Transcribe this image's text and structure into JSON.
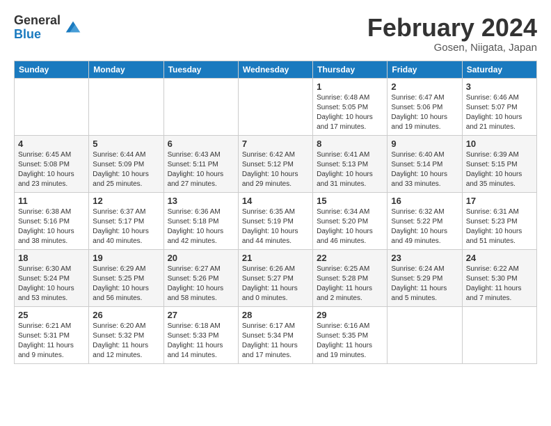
{
  "logo": {
    "general": "General",
    "blue": "Blue"
  },
  "title": "February 2024",
  "location": "Gosen, Niigata, Japan",
  "weekdays": [
    "Sunday",
    "Monday",
    "Tuesday",
    "Wednesday",
    "Thursday",
    "Friday",
    "Saturday"
  ],
  "weeks": [
    [
      {
        "day": "",
        "info": ""
      },
      {
        "day": "",
        "info": ""
      },
      {
        "day": "",
        "info": ""
      },
      {
        "day": "",
        "info": ""
      },
      {
        "day": "1",
        "info": "Sunrise: 6:48 AM\nSunset: 5:05 PM\nDaylight: 10 hours and 17 minutes."
      },
      {
        "day": "2",
        "info": "Sunrise: 6:47 AM\nSunset: 5:06 PM\nDaylight: 10 hours and 19 minutes."
      },
      {
        "day": "3",
        "info": "Sunrise: 6:46 AM\nSunset: 5:07 PM\nDaylight: 10 hours and 21 minutes."
      }
    ],
    [
      {
        "day": "4",
        "info": "Sunrise: 6:45 AM\nSunset: 5:08 PM\nDaylight: 10 hours and 23 minutes."
      },
      {
        "day": "5",
        "info": "Sunrise: 6:44 AM\nSunset: 5:09 PM\nDaylight: 10 hours and 25 minutes."
      },
      {
        "day": "6",
        "info": "Sunrise: 6:43 AM\nSunset: 5:11 PM\nDaylight: 10 hours and 27 minutes."
      },
      {
        "day": "7",
        "info": "Sunrise: 6:42 AM\nSunset: 5:12 PM\nDaylight: 10 hours and 29 minutes."
      },
      {
        "day": "8",
        "info": "Sunrise: 6:41 AM\nSunset: 5:13 PM\nDaylight: 10 hours and 31 minutes."
      },
      {
        "day": "9",
        "info": "Sunrise: 6:40 AM\nSunset: 5:14 PM\nDaylight: 10 hours and 33 minutes."
      },
      {
        "day": "10",
        "info": "Sunrise: 6:39 AM\nSunset: 5:15 PM\nDaylight: 10 hours and 35 minutes."
      }
    ],
    [
      {
        "day": "11",
        "info": "Sunrise: 6:38 AM\nSunset: 5:16 PM\nDaylight: 10 hours and 38 minutes."
      },
      {
        "day": "12",
        "info": "Sunrise: 6:37 AM\nSunset: 5:17 PM\nDaylight: 10 hours and 40 minutes."
      },
      {
        "day": "13",
        "info": "Sunrise: 6:36 AM\nSunset: 5:18 PM\nDaylight: 10 hours and 42 minutes."
      },
      {
        "day": "14",
        "info": "Sunrise: 6:35 AM\nSunset: 5:19 PM\nDaylight: 10 hours and 44 minutes."
      },
      {
        "day": "15",
        "info": "Sunrise: 6:34 AM\nSunset: 5:20 PM\nDaylight: 10 hours and 46 minutes."
      },
      {
        "day": "16",
        "info": "Sunrise: 6:32 AM\nSunset: 5:22 PM\nDaylight: 10 hours and 49 minutes."
      },
      {
        "day": "17",
        "info": "Sunrise: 6:31 AM\nSunset: 5:23 PM\nDaylight: 10 hours and 51 minutes."
      }
    ],
    [
      {
        "day": "18",
        "info": "Sunrise: 6:30 AM\nSunset: 5:24 PM\nDaylight: 10 hours and 53 minutes."
      },
      {
        "day": "19",
        "info": "Sunrise: 6:29 AM\nSunset: 5:25 PM\nDaylight: 10 hours and 56 minutes."
      },
      {
        "day": "20",
        "info": "Sunrise: 6:27 AM\nSunset: 5:26 PM\nDaylight: 10 hours and 58 minutes."
      },
      {
        "day": "21",
        "info": "Sunrise: 6:26 AM\nSunset: 5:27 PM\nDaylight: 11 hours and 0 minutes."
      },
      {
        "day": "22",
        "info": "Sunrise: 6:25 AM\nSunset: 5:28 PM\nDaylight: 11 hours and 2 minutes."
      },
      {
        "day": "23",
        "info": "Sunrise: 6:24 AM\nSunset: 5:29 PM\nDaylight: 11 hours and 5 minutes."
      },
      {
        "day": "24",
        "info": "Sunrise: 6:22 AM\nSunset: 5:30 PM\nDaylight: 11 hours and 7 minutes."
      }
    ],
    [
      {
        "day": "25",
        "info": "Sunrise: 6:21 AM\nSunset: 5:31 PM\nDaylight: 11 hours and 9 minutes."
      },
      {
        "day": "26",
        "info": "Sunrise: 6:20 AM\nSunset: 5:32 PM\nDaylight: 11 hours and 12 minutes."
      },
      {
        "day": "27",
        "info": "Sunrise: 6:18 AM\nSunset: 5:33 PM\nDaylight: 11 hours and 14 minutes."
      },
      {
        "day": "28",
        "info": "Sunrise: 6:17 AM\nSunset: 5:34 PM\nDaylight: 11 hours and 17 minutes."
      },
      {
        "day": "29",
        "info": "Sunrise: 6:16 AM\nSunset: 5:35 PM\nDaylight: 11 hours and 19 minutes."
      },
      {
        "day": "",
        "info": ""
      },
      {
        "day": "",
        "info": ""
      }
    ]
  ]
}
